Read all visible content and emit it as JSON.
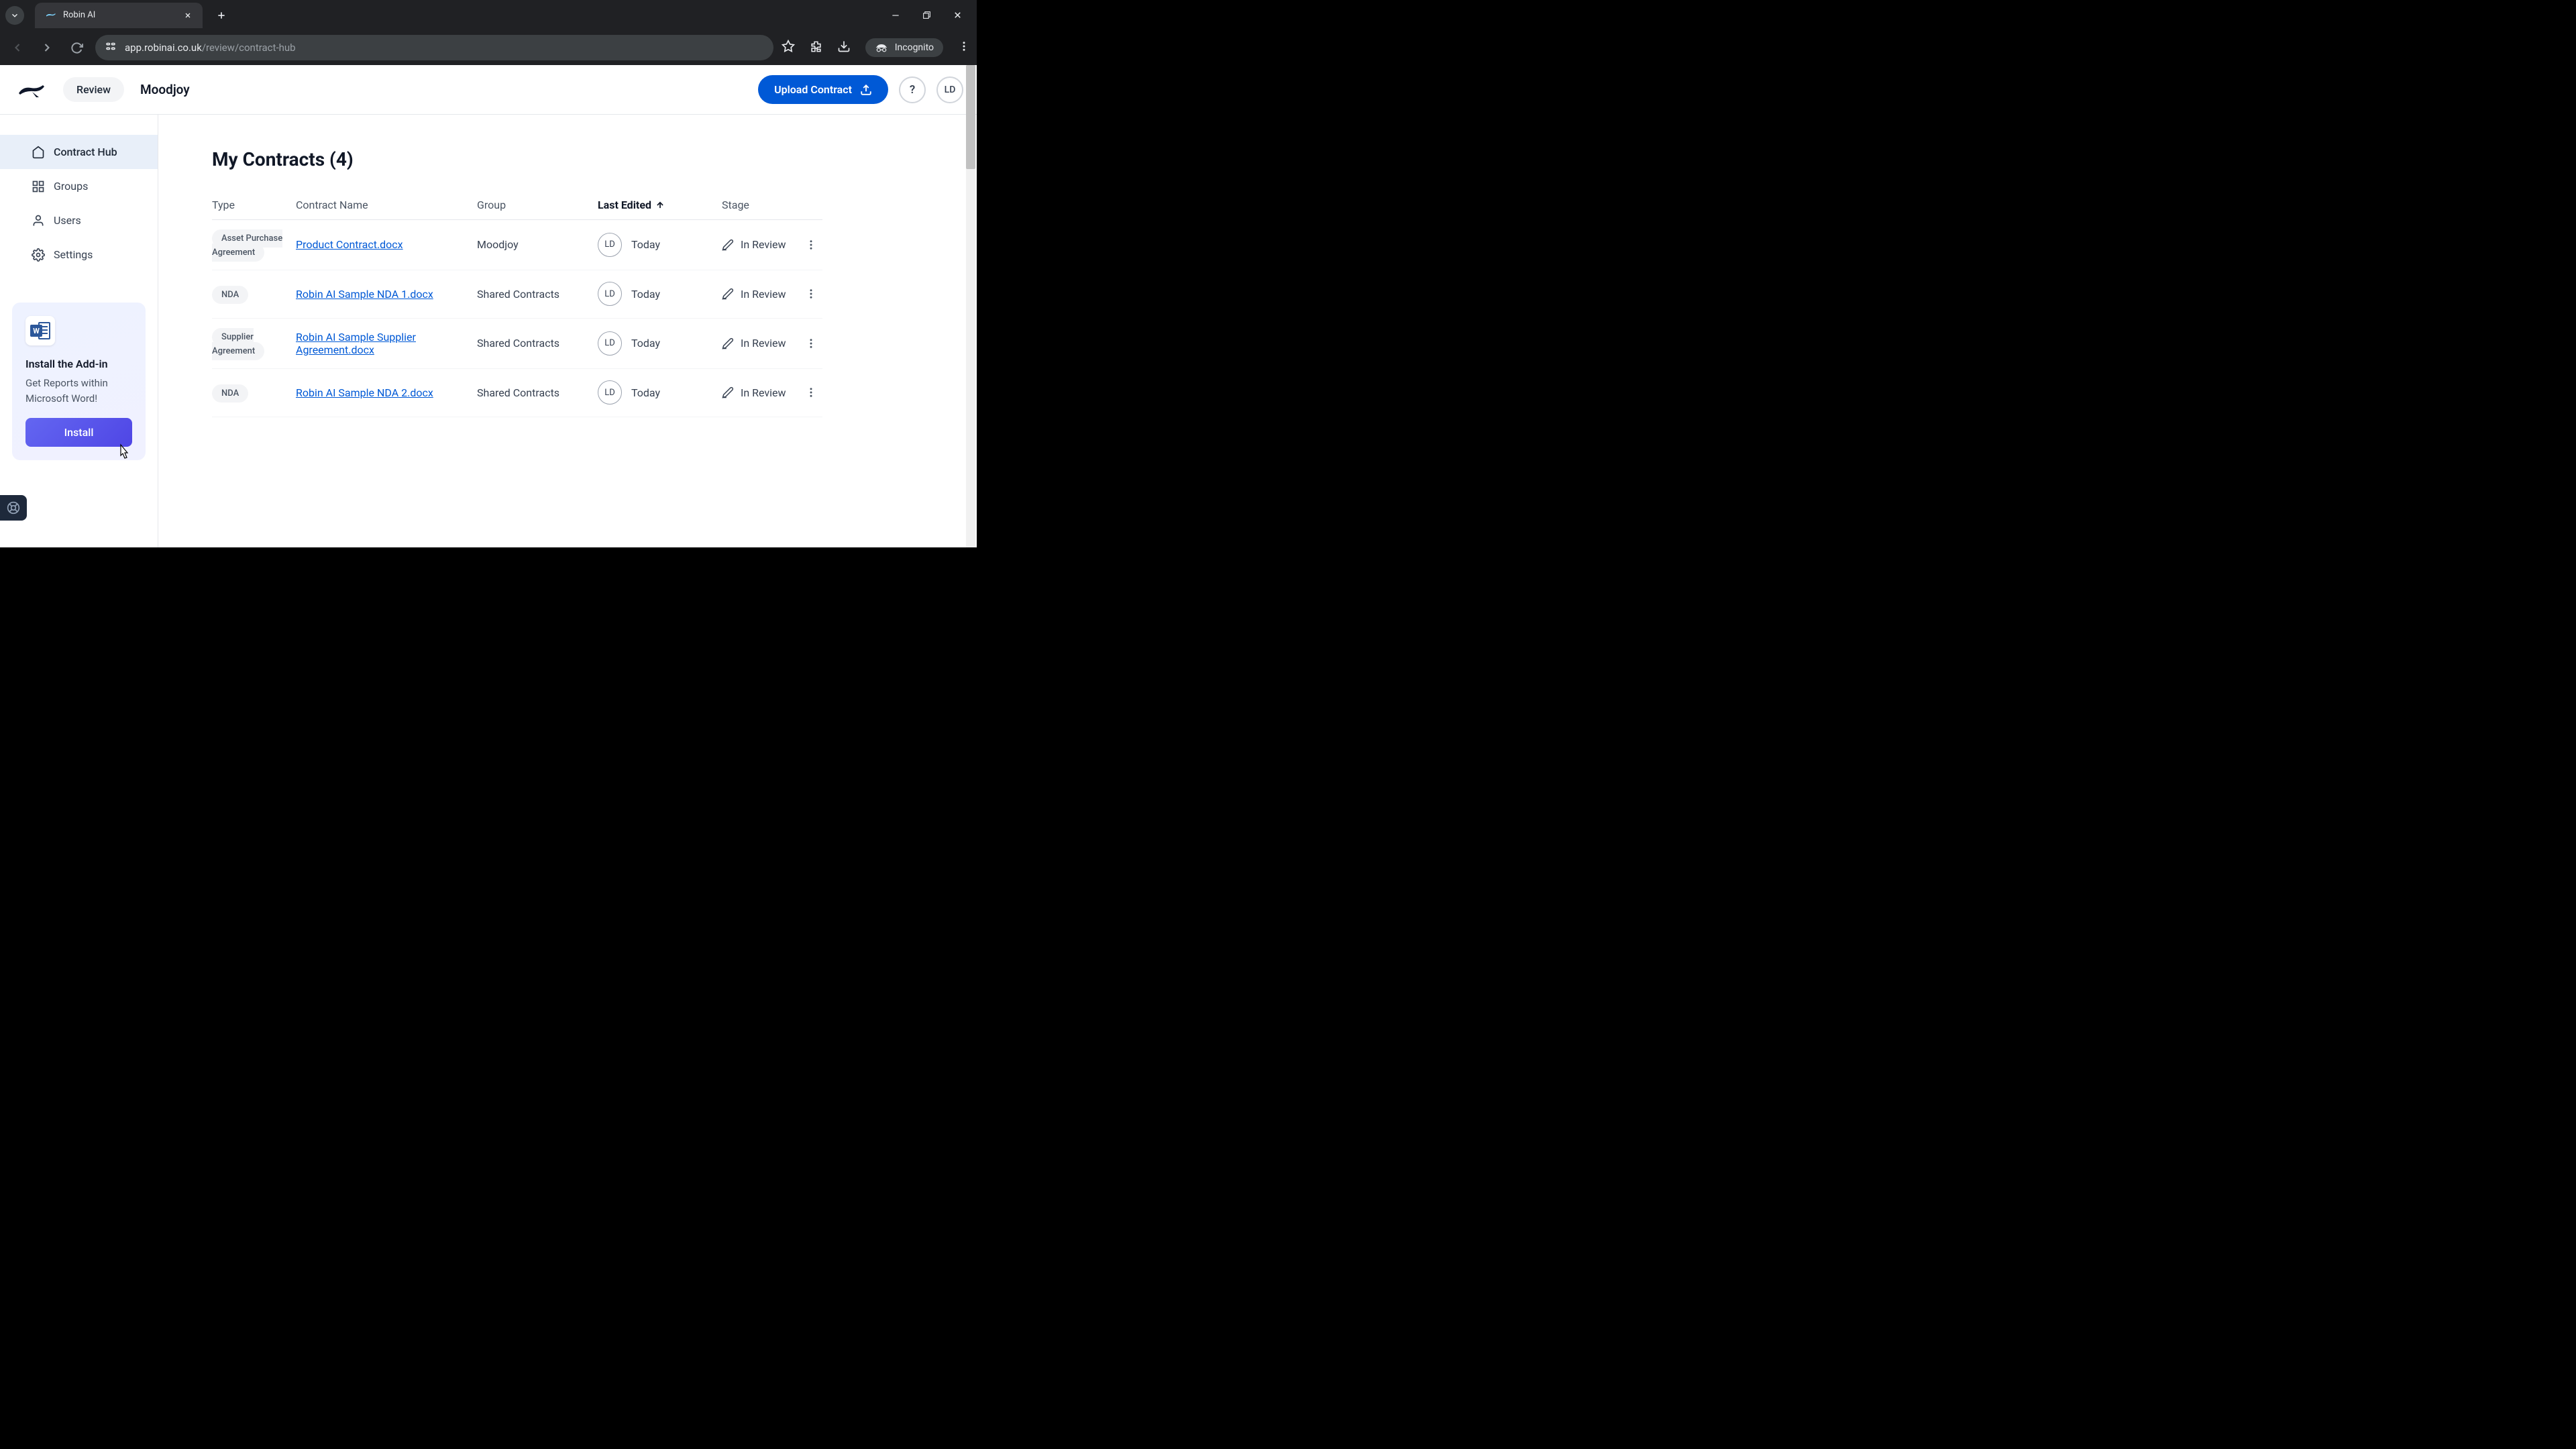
{
  "browser": {
    "tab_title": "Robin AI",
    "url_domain": "app.robinai.co.uk",
    "url_path": "/review/contract-hub",
    "incognito_label": "Incognito"
  },
  "header": {
    "review_label": "Review",
    "org_name": "Moodjoy",
    "upload_label": "Upload Contract",
    "help_label": "?",
    "avatar_initials": "LD"
  },
  "sidebar": {
    "items": [
      {
        "label": "Contract Hub"
      },
      {
        "label": "Groups"
      },
      {
        "label": "Users"
      },
      {
        "label": "Settings"
      }
    ],
    "addin": {
      "title": "Install the Add-in",
      "description": "Get Reports within Microsoft Word!",
      "button": "Install",
      "word_letter": "W"
    }
  },
  "main": {
    "title": "My Contracts (4)",
    "columns": {
      "type": "Type",
      "name": "Contract Name",
      "group": "Group",
      "edited": "Last Edited",
      "stage": "Stage"
    },
    "rows": [
      {
        "type": "Asset Purchase Agreement",
        "name": "Product Contract.docx",
        "group": "Moodjoy",
        "editor": "LD",
        "when": "Today",
        "stage": "In Review"
      },
      {
        "type": "NDA",
        "name": "Robin AI Sample NDA 1.docx",
        "group": "Shared Contracts",
        "editor": "LD",
        "when": "Today",
        "stage": "In Review"
      },
      {
        "type": "Supplier Agreement",
        "name": "Robin AI Sample Supplier Agreement.docx",
        "group": "Shared Contracts",
        "editor": "LD",
        "when": "Today",
        "stage": "In Review"
      },
      {
        "type": "NDA",
        "name": "Robin AI Sample NDA 2.docx",
        "group": "Shared Contracts",
        "editor": "LD",
        "when": "Today",
        "stage": "In Review"
      }
    ]
  }
}
